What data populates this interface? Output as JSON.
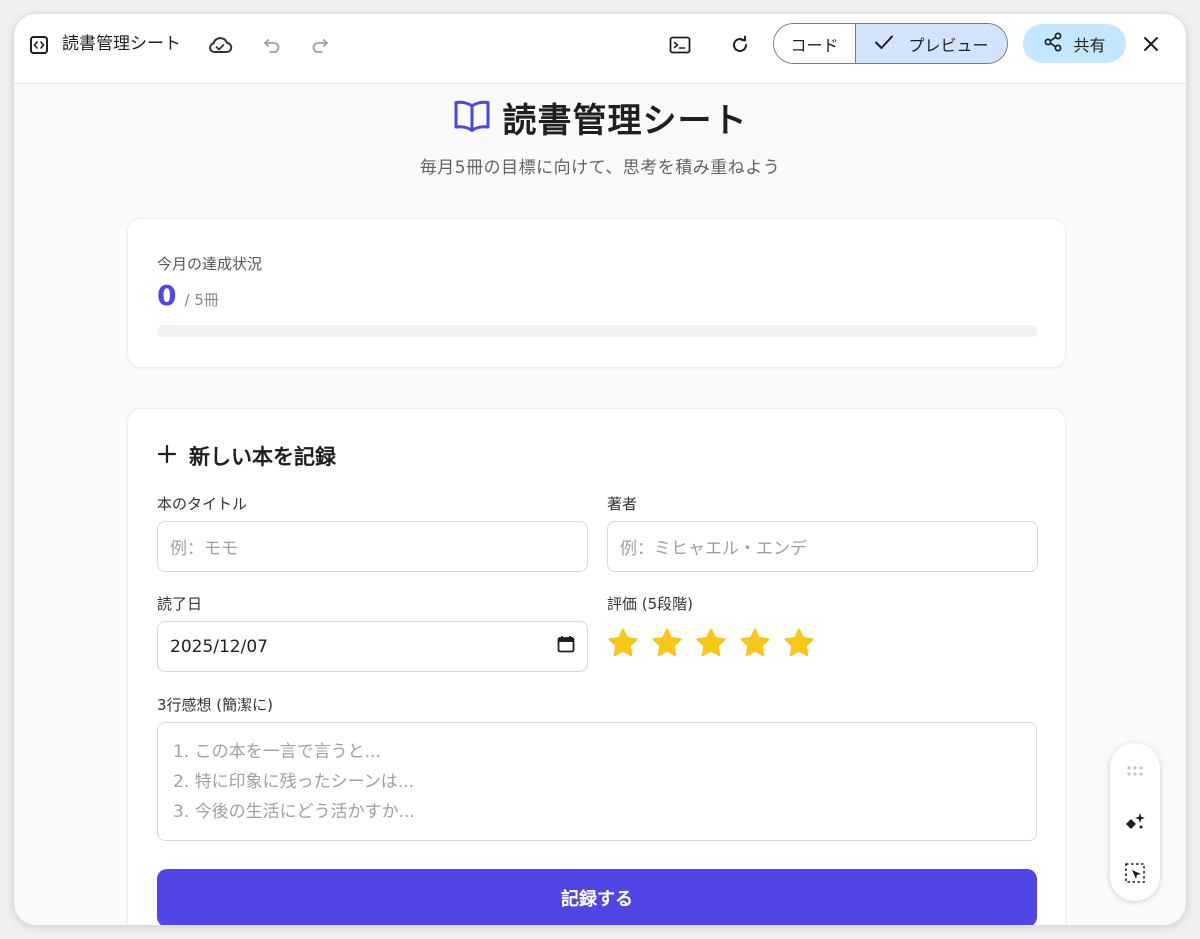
{
  "topbar": {
    "app_title": "読書管理シート",
    "toggle_code": "コード",
    "toggle_preview": "プレビュー",
    "share_label": "共有",
    "icons": [
      "code-file-icon",
      "cloud-icon",
      "undo-icon",
      "redo-icon",
      "terminal-icon",
      "refresh-icon",
      "check-icon",
      "share-icon",
      "close-icon"
    ]
  },
  "page": {
    "title": "読書管理シート",
    "subtitle": "毎月5冊の目標に向けて、思考を積み重ねよう",
    "accent_color": "#4f46e5",
    "star_color": "#fbc617"
  },
  "progress": {
    "label": "今月の達成状況",
    "done": "0",
    "goal_text": "/ 5冊",
    "fraction": 0
  },
  "form": {
    "title": "新しい本を記録",
    "book_title_label": "本のタイトル",
    "book_title_placeholder": "例：モモ",
    "author_label": "著者",
    "author_placeholder": "例：ミヒャエル・エンデ",
    "date_label": "読了日",
    "date_value": "2025/12/07",
    "rating_label": "評価 (5段階)",
    "rating_value": 5,
    "rating_max": 5,
    "impression_label": "3行感想 (簡潔に)",
    "impression_placeholder_lines": [
      "1. この本を一言で言うと...",
      "2. 特に印象に残ったシーンは...",
      "3. 今後の生活にどう活かすか..."
    ],
    "submit_label": "記録する"
  },
  "float_panel": {
    "icons": [
      "drag-handle-icon",
      "ai-sparkle-icon",
      "select-element-icon"
    ]
  }
}
